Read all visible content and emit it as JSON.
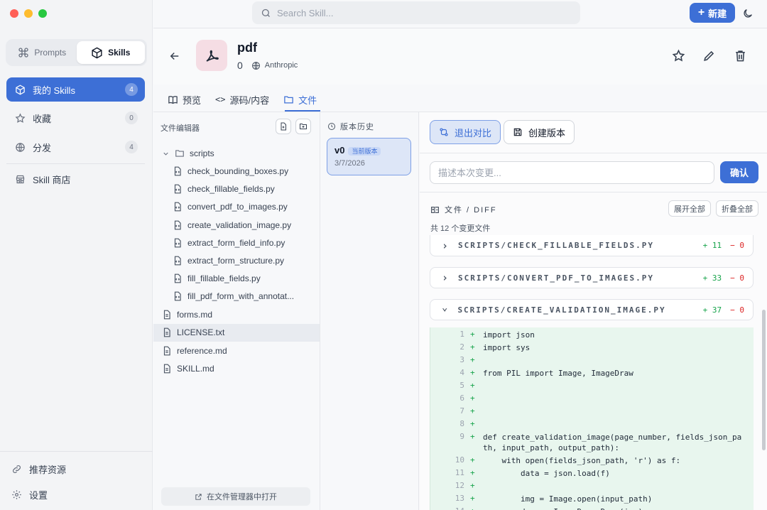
{
  "window": {
    "traffic_colors": [
      "#ff5f57",
      "#febc2e",
      "#28c840"
    ]
  },
  "sidebar": {
    "segments": [
      {
        "label": "Prompts",
        "icon": "command-icon"
      },
      {
        "label": "Skills",
        "icon": "cube-icon",
        "active": true
      }
    ],
    "items": [
      {
        "label": "我的 Skills",
        "count": "4",
        "icon": "cube-icon",
        "active": true
      },
      {
        "label": "收藏",
        "count": "0",
        "icon": "star-icon"
      },
      {
        "label": "分发",
        "count": "4",
        "icon": "globe-icon"
      },
      {
        "label": "Skill 商店",
        "icon": "store-icon"
      }
    ],
    "bottom": [
      {
        "label": "推荐资源",
        "icon": "link-icon"
      },
      {
        "label": "设置",
        "icon": "gear-icon"
      }
    ]
  },
  "topbar": {
    "search_placeholder": "Search Skill...",
    "new_label": "新建"
  },
  "skill": {
    "name": "pdf",
    "count": "0",
    "author": "Anthropic"
  },
  "tabs": [
    {
      "label": "预览",
      "icon": "book-icon"
    },
    {
      "label": "源码/内容",
      "icon": "code-icon"
    },
    {
      "label": "文件",
      "icon": "folder-icon",
      "active": true
    }
  ],
  "file_editor": {
    "title": "文件编辑器",
    "folder": "scripts",
    "scripts": [
      "check_bounding_boxes.py",
      "check_fillable_fields.py",
      "convert_pdf_to_images.py",
      "create_validation_image.py",
      "extract_form_field_info.py",
      "extract_form_structure.py",
      "fill_fillable_fields.py",
      "fill_pdf_form_with_annotat..."
    ],
    "root_files": [
      "forms.md",
      "LICENSE.txt",
      "reference.md",
      "SKILL.md"
    ],
    "selected": "LICENSE.txt",
    "open_in_fm": "在文件管理器中打开"
  },
  "versions": {
    "title": "版本历史",
    "items": [
      {
        "version": "v0",
        "badge": "当前版本",
        "date": "3/7/2026"
      }
    ]
  },
  "diff": {
    "exit_compare": "退出对比",
    "create_version": "创建版本",
    "desc_placeholder": "描述本次变更...",
    "confirm": "确认",
    "section": "文件 / DIFF",
    "expand_all": "展开全部",
    "collapse_all": "折叠全部",
    "changed_files": "共 12 个变更文件",
    "files": [
      {
        "name": "SCRIPTS/CHECK_FILLABLE_FIELDS.PY",
        "add": "+ 11",
        "del": "− 0",
        "expanded": false
      },
      {
        "name": "SCRIPTS/CONVERT_PDF_TO_IMAGES.PY",
        "add": "+ 33",
        "del": "− 0",
        "expanded": false
      },
      {
        "name": "SCRIPTS/CREATE_VALIDATION_IMAGE.PY",
        "add": "+ 37",
        "del": "− 0",
        "expanded": true
      }
    ],
    "lines": [
      {
        "n": "1",
        "t": "import json"
      },
      {
        "n": "2",
        "t": "import sys"
      },
      {
        "n": "3",
        "t": ""
      },
      {
        "n": "4",
        "t": "from PIL import Image, ImageDraw"
      },
      {
        "n": "5",
        "t": ""
      },
      {
        "n": "6",
        "t": ""
      },
      {
        "n": "7",
        "t": ""
      },
      {
        "n": "8",
        "t": ""
      },
      {
        "n": "9",
        "t": "def create_validation_image(page_number, fields_json_path, input_path, output_path):"
      },
      {
        "n": "10",
        "t": "    with open(fields_json_path, 'r') as f:"
      },
      {
        "n": "11",
        "t": "        data = json.load(f)"
      },
      {
        "n": "12",
        "t": ""
      },
      {
        "n": "13",
        "t": "        img = Image.open(input_path)"
      },
      {
        "n": "14",
        "t": "        draw = ImageDraw.Draw(img)"
      }
    ]
  },
  "colors": {
    "accent": "#3d6fd6",
    "add": "#16a34a",
    "del": "#dc2626"
  }
}
